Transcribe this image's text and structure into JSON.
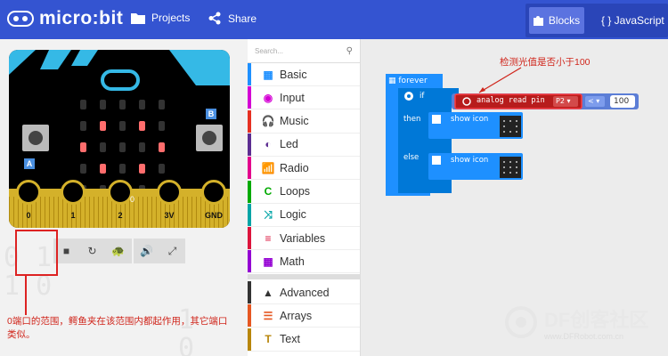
{
  "header": {
    "logo_text": "micro:bit",
    "projects": "Projects",
    "share": "Share",
    "blocks": "Blocks",
    "javascript": "{ } JavaScript"
  },
  "board": {
    "button_a": "A",
    "button_b": "B",
    "pins": [
      "0",
      "1",
      "2",
      "3V",
      "GND"
    ],
    "small_label": "0"
  },
  "sim_controls": [
    "■",
    "↻",
    "🐢",
    "🔊",
    "⤢"
  ],
  "annotation": {
    "note": "0端口的范围，鳄鱼夹在该范围内都起作用，其它端口类似。",
    "callout": "检测光值是否小于100"
  },
  "toolbox": {
    "search_placeholder": "Search...",
    "categories": [
      {
        "label": "Basic",
        "color": "#1e90ff",
        "icon": "▦"
      },
      {
        "label": "Input",
        "color": "#d400d4",
        "icon": "◉"
      },
      {
        "label": "Music",
        "color": "#e63022",
        "icon": "🎧"
      },
      {
        "label": "Led",
        "color": "#5c2d91",
        "icon": "◐"
      },
      {
        "label": "Radio",
        "color": "#e3008c",
        "icon": "📶"
      },
      {
        "label": "Loops",
        "color": "#00aa00",
        "icon": "C"
      },
      {
        "label": "Logic",
        "color": "#00a4a6",
        "icon": "⤨"
      },
      {
        "label": "Variables",
        "color": "#dc143c",
        "icon": "≡"
      },
      {
        "label": "Math",
        "color": "#9400d3",
        "icon": "▦"
      },
      {
        "label": "Advanced",
        "color": "#333333",
        "icon": "▲"
      },
      {
        "label": "Arrays",
        "color": "#e65722",
        "icon": "☰"
      },
      {
        "label": "Text",
        "color": "#b8860b",
        "icon": "T"
      }
    ]
  },
  "blocks": {
    "forever": "forever",
    "if": "if",
    "then": "then",
    "else": "else",
    "show_icon_1": "show icon",
    "show_icon_2": "show icon",
    "analog_read": "analog read pin",
    "pin_value": "P2 ▾",
    "operator": "< ▾",
    "compare_value": "100"
  },
  "watermark": {
    "title": "DF创客社区",
    "url": "www.DFRobot.com.cn"
  },
  "colors": {
    "header": "#3454d1",
    "basic_block": "#1e90ff",
    "logic_block": "#0078d7",
    "pins_block": "#b71c1c",
    "annotation": "#d0261c"
  }
}
